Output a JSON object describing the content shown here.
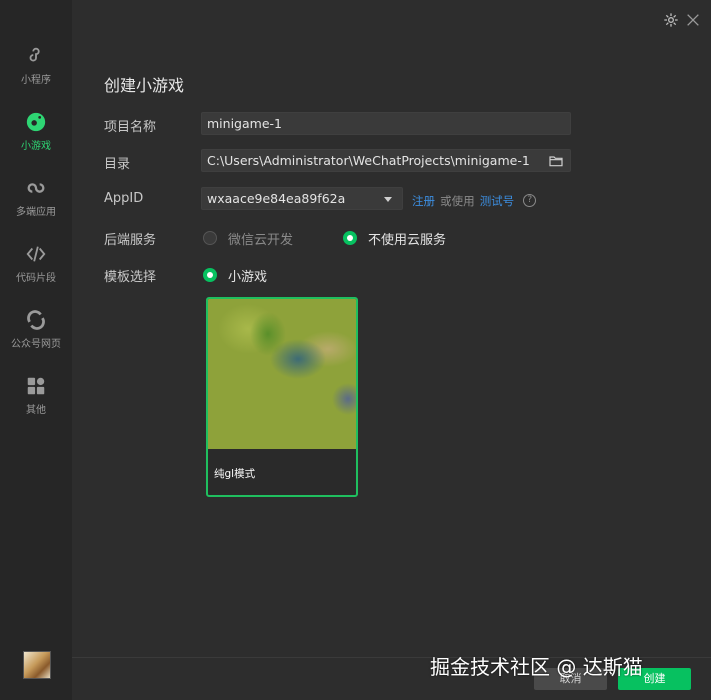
{
  "sidebar": {
    "items": [
      {
        "label": "小程序",
        "icon": "miniprogram-icon"
      },
      {
        "label": "小游戏",
        "icon": "minigame-icon"
      },
      {
        "label": "多端应用",
        "icon": "multiplatform-icon"
      },
      {
        "label": "代码片段",
        "icon": "code-snippet-icon"
      },
      {
        "label": "公众号网页",
        "icon": "official-account-icon"
      },
      {
        "label": "其他",
        "icon": "other-apps-icon"
      }
    ],
    "active_index": 1
  },
  "form": {
    "title": "创建小游戏",
    "project_name": {
      "label": "项目名称",
      "value": "minigame-1"
    },
    "directory": {
      "label": "目录",
      "value": "C:\\Users\\Administrator\\WeChatProjects\\minigame-1"
    },
    "appid": {
      "label": "AppID",
      "value": "wxaace9e84ea89f62a",
      "register_link": "注册",
      "or_use": "或使用",
      "test_link": "测试号",
      "help": "?"
    },
    "backend": {
      "label": "后端服务",
      "options": [
        "微信云开发",
        "不使用云服务"
      ],
      "selected": 1
    },
    "template": {
      "label": "模板选择",
      "option": "小游戏",
      "card_label": "纯gl模式"
    }
  },
  "footer": {
    "cancel": "取消",
    "create": "创建"
  },
  "watermark": "掘金技术社区 @ 达斯猫",
  "colors": {
    "accent": "#07c160",
    "link": "#3c8ee0",
    "background": "#2d2d2d",
    "sidebar": "#262626"
  }
}
